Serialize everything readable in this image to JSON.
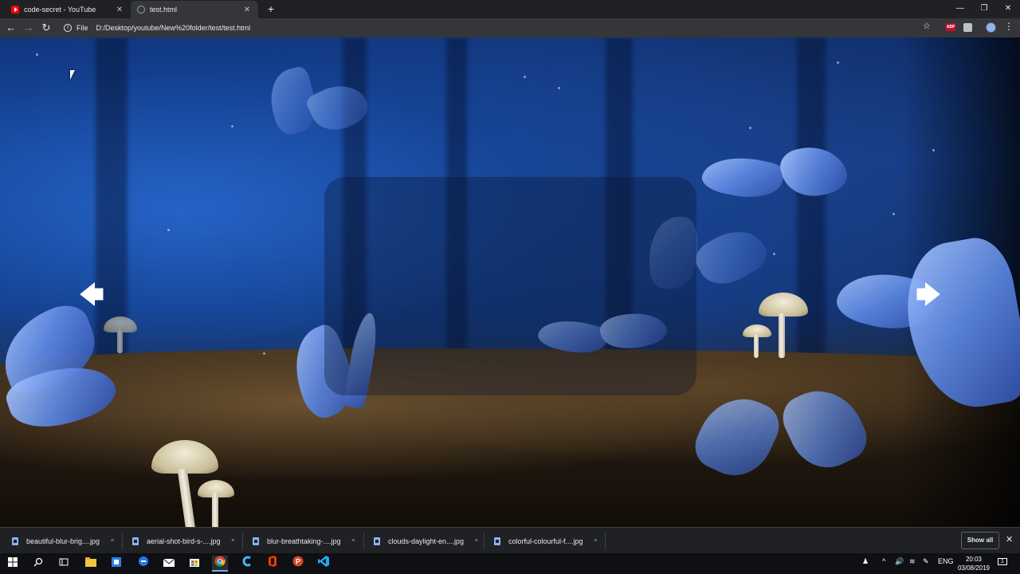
{
  "browser": {
    "tabs": [
      {
        "title": "code-secret - YouTube",
        "icon": "youtube-icon",
        "active": false
      },
      {
        "title": "test.html",
        "icon": "globe-icon",
        "active": true
      }
    ],
    "new_tab_symbol": "+",
    "close_symbol": "✕",
    "window_controls": {
      "minimize": "—",
      "restore": "❐",
      "close": "✕"
    },
    "nav": {
      "back": "←",
      "forward": "→",
      "reload": "↻"
    },
    "omnibox": {
      "scheme_label": "File",
      "url": "D:/Desktop/youtube/New%20folder/test/test.html",
      "info_symbol": "i"
    },
    "toolbar_icons": {
      "star": "☆",
      "abp_label": "ABP",
      "menu": "⋮"
    }
  },
  "page": {
    "slider": {
      "prev_arrow": "🡄",
      "next_arrow": "🡆"
    },
    "background": "butterflies-and-mushrooms-forest"
  },
  "downloads": {
    "items": [
      {
        "name": "beautiful-blur-brig....jpg"
      },
      {
        "name": "aerial-shot-bird-s-....jpg"
      },
      {
        "name": "blur-breathtaking-....jpg"
      },
      {
        "name": "clouds-daylight-en....jpg"
      },
      {
        "name": "colorful-colourful-f....jpg"
      }
    ],
    "caret_symbol": "^",
    "show_all_label": "Show all",
    "close_symbol": "✕"
  },
  "taskbar": {
    "icons": [
      "windows-start",
      "search",
      "task-view",
      "file-explorer",
      "store-app",
      "edge",
      "mail",
      "microsoft-store",
      "chrome",
      "app-c",
      "office",
      "powerpoint",
      "vscode"
    ],
    "tray": {
      "language": "ENG"
    },
    "clock": {
      "time": "20:03",
      "date": "03/08/2019"
    },
    "notification_count": "1"
  },
  "colors": {
    "chrome_dark": "#202124",
    "toolbar": "#35363a",
    "accent_blue": "#8ab4f8",
    "youtube_red": "#ff0000"
  }
}
